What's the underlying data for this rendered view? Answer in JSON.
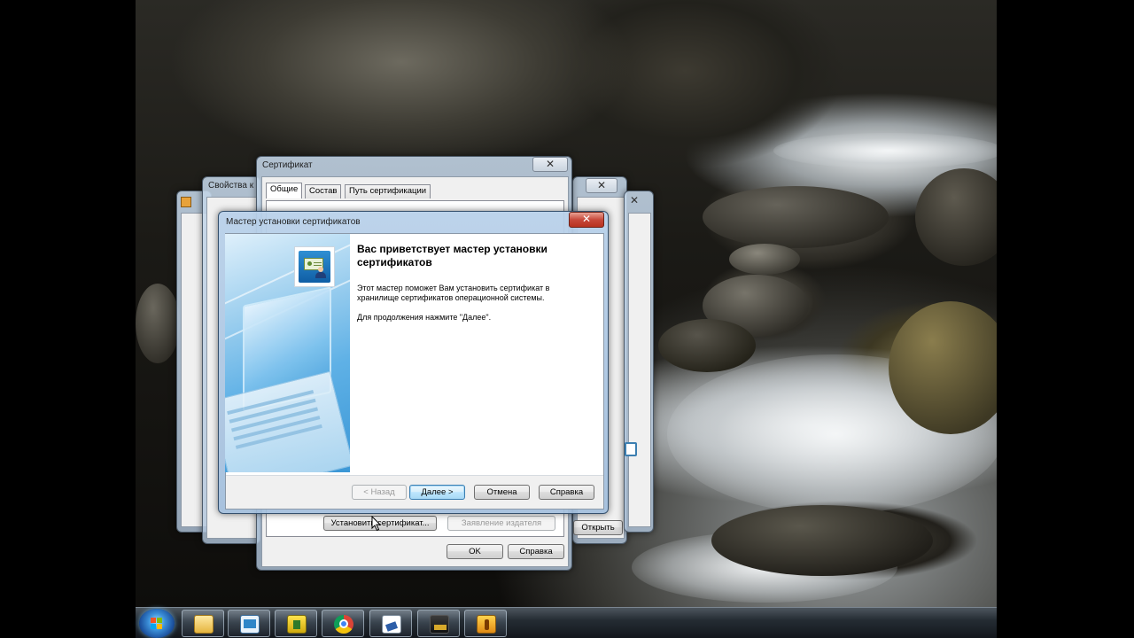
{
  "windows": {
    "properties": {
      "title": "Свойства к"
    },
    "certificate": {
      "title": "Сертификат",
      "close_glyph": "✕",
      "tabs": [
        "Общие",
        "Состав",
        "Путь сертификации"
      ],
      "install_button": "Установить сертификат...",
      "issuer_statement_button": "Заявление издателя",
      "ok_button": "OK",
      "help_button": "Справка"
    },
    "back_window": {
      "close_glyph": "✕",
      "open_button": "Открыть"
    },
    "wizard": {
      "title": "Мастер установки сертификатов",
      "close_glyph": "✕",
      "heading": "Вас приветствует мастер установки сертификатов",
      "description": "Этот мастер поможет Вам установить сертификат в хранилище сертификатов операционной системы.",
      "continue_hint": "Для продолжения нажмите \"Далее\".",
      "buttons": {
        "back": "< Назад",
        "next": "Далее >",
        "cancel": "Отмена",
        "help": "Справка"
      }
    }
  },
  "taskbar": {
    "items": [
      {
        "icon": "explorer-icon"
      },
      {
        "icon": "certificate-tool-icon"
      },
      {
        "icon": "network-app-icon"
      },
      {
        "icon": "chrome-icon"
      },
      {
        "icon": "document-app-icon"
      },
      {
        "icon": "crypto-app-icon"
      },
      {
        "icon": "security-app-icon"
      }
    ]
  }
}
